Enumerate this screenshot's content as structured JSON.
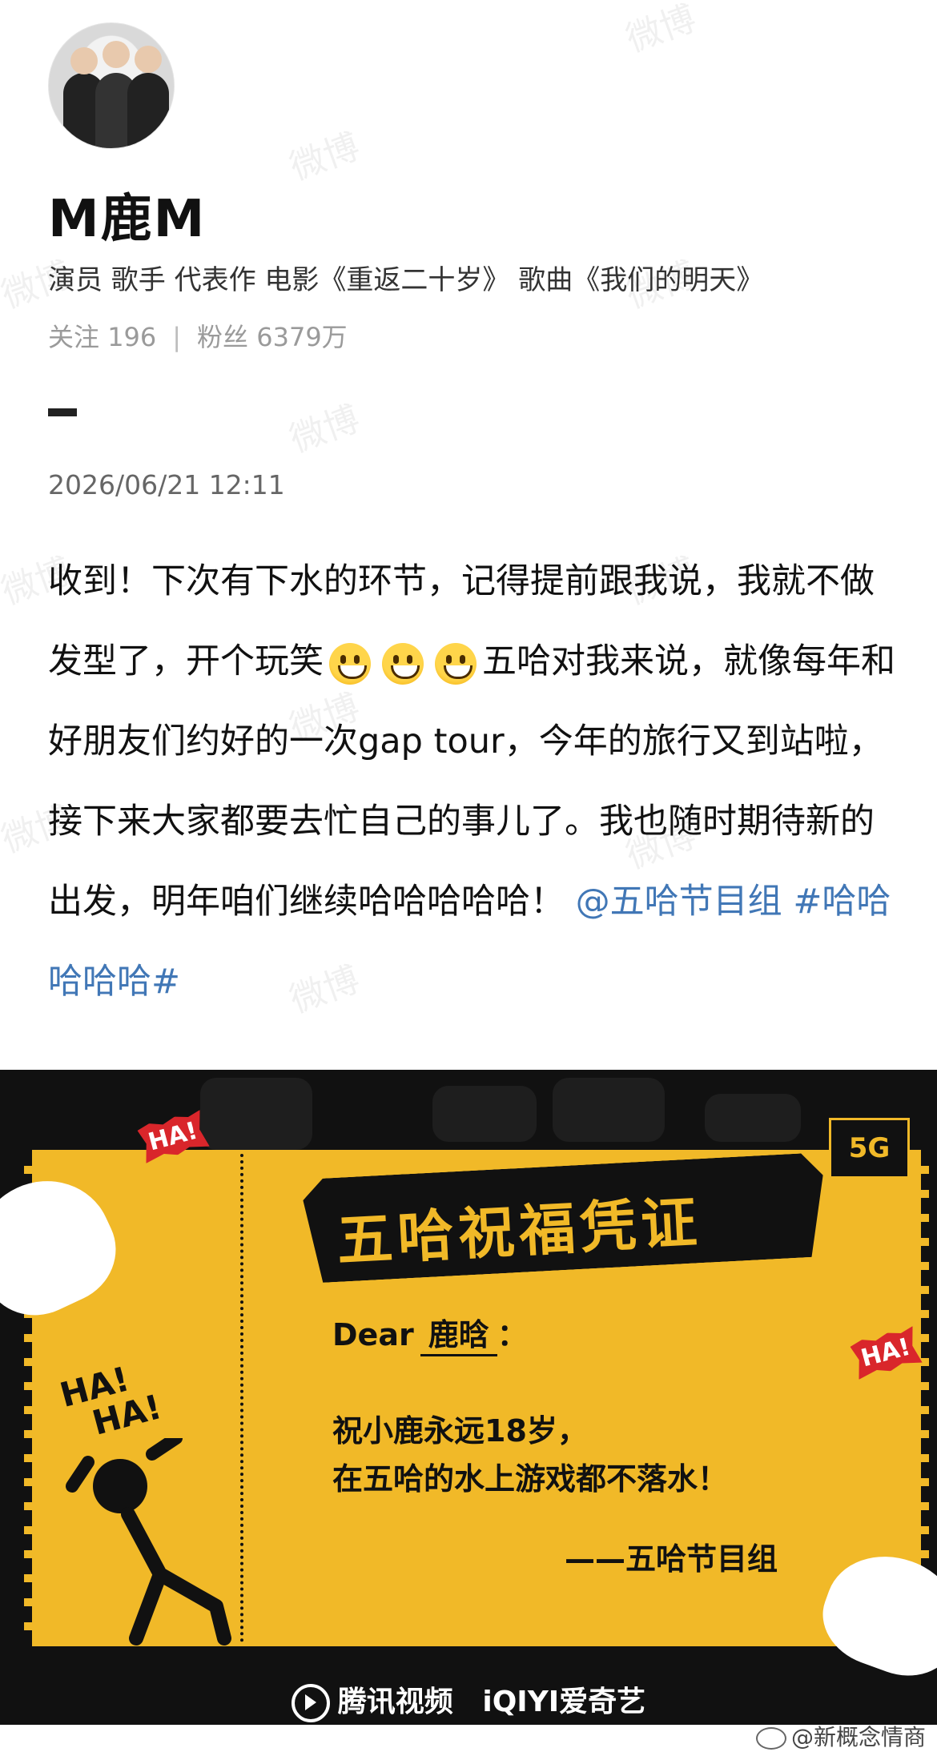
{
  "profile": {
    "name": "M鹿M",
    "bio": "演员 歌手 代表作 电影《重返二十岁》 歌曲《我们的明天》",
    "following_label": "关注",
    "following_count": "196",
    "separator": "|",
    "followers_label": "粉丝",
    "followers_count": "6379万"
  },
  "post": {
    "timestamp": "2026/06/21 12:11",
    "text_part1": "收到！下次有下水的环节，记得提前跟我说，我就不做发型了，开个玩笑",
    "text_part2": "五哈对我来说，就像每年和好朋友们约好的一次gap tour，今年的旅行又到站啦，接下来大家都要去忙自己的事儿了。我也随时期待新的出发，明年咱们继续哈哈哈哈哈！",
    "mention": "@五哈节目组",
    "hashtag": "#哈哈哈哈哈#",
    "emoji_name": "grinning-face-icon"
  },
  "banner": {
    "title": "五哈祝福凭证",
    "dear_label": "Dear",
    "dear_name": "鹿晗",
    "dear_colon": "：",
    "wish_line1": "祝小鹿永远18岁，",
    "wish_line2": "在五哈的水上游戏都不落水！",
    "signature": "——五哈节目组",
    "season_badge": "5G",
    "ha_badge_1": "HA!",
    "ha_badge_2": "HA!",
    "haha_line1": "HA!",
    "haha_line2": "HA!",
    "sponsor_1": "腾讯视频",
    "sponsor_2_brand": "iQIYI",
    "sponsor_2_name": "爱奇艺",
    "colors": {
      "yellow": "#f1b928",
      "black": "#111111",
      "red": "#d9262b"
    }
  },
  "credit": {
    "text": "@新概念情商"
  },
  "watermark": {
    "text": "微博"
  }
}
